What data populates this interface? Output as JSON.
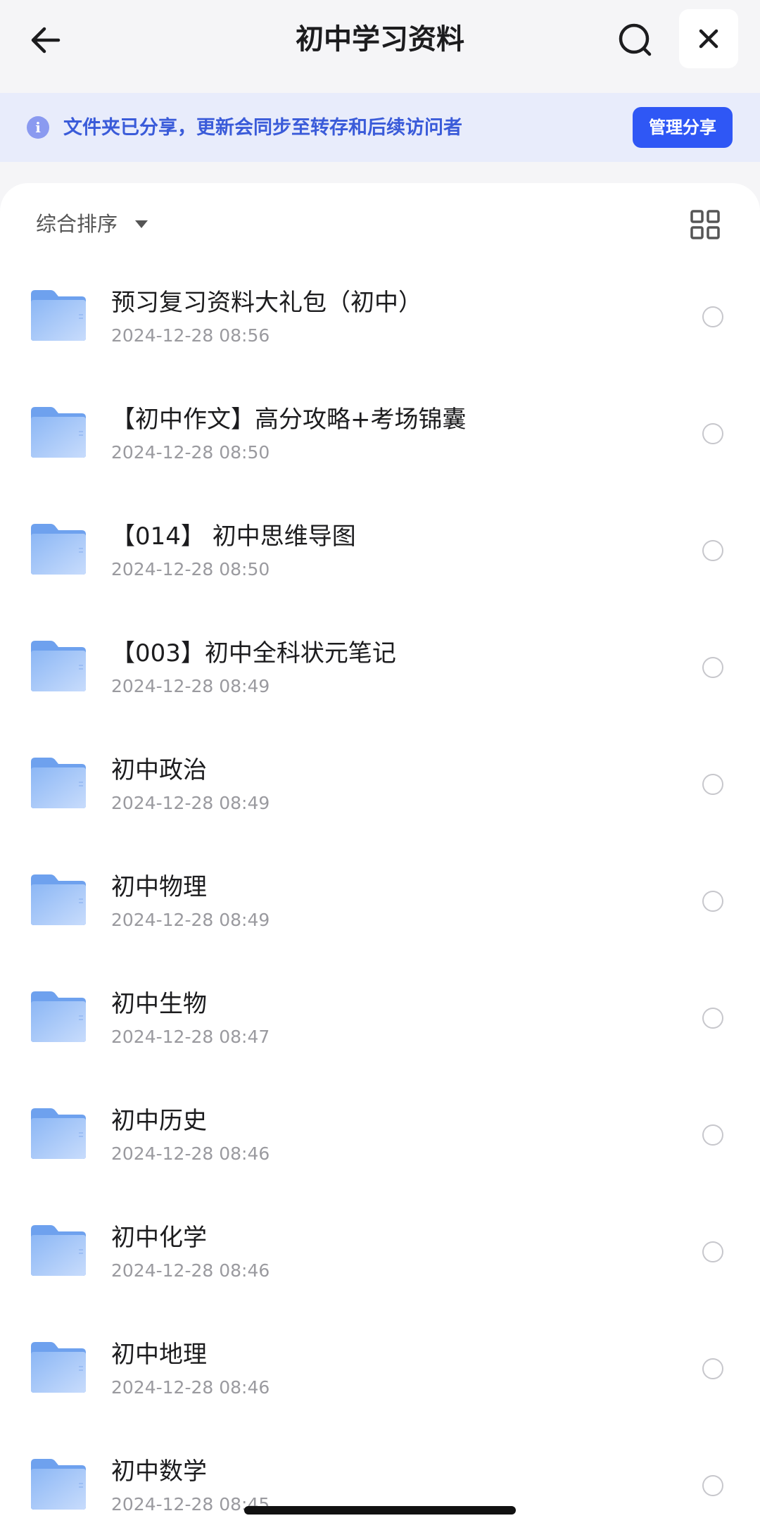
{
  "header": {
    "title": "初中学习资料",
    "back_icon": "arrow-left-icon",
    "search_icon": "search-icon",
    "close_icon": "close-icon"
  },
  "banner": {
    "icon": "info-icon",
    "info_glyph": "i",
    "text": "文件夹已分享，更新会同步至转存和后续访问者",
    "manage_label": "管理分享"
  },
  "toolbar": {
    "sort_label": "综合排序",
    "view_icon": "grid-view-icon"
  },
  "items": [
    {
      "name": "预习复习资料大礼包（初中）",
      "date": "2024-12-28 08:56"
    },
    {
      "name": "【初中作文】高分攻略+考场锦囊",
      "date": "2024-12-28 08:50"
    },
    {
      "name": "【014】 初中思维导图",
      "date": "2024-12-28 08:50"
    },
    {
      "name": "【003】初中全科状元笔记",
      "date": "2024-12-28 08:49"
    },
    {
      "name": "初中政治",
      "date": "2024-12-28 08:49"
    },
    {
      "name": "初中物理",
      "date": "2024-12-28 08:49"
    },
    {
      "name": "初中生物",
      "date": "2024-12-28 08:47"
    },
    {
      "name": "初中历史",
      "date": "2024-12-28 08:46"
    },
    {
      "name": "初中化学",
      "date": "2024-12-28 08:46"
    },
    {
      "name": "初中地理",
      "date": "2024-12-28 08:46"
    },
    {
      "name": "初中数学",
      "date": "2024-12-28 08:45"
    }
  ],
  "colors": {
    "accent": "#2f57f5",
    "banner_bg": "#e8ecfb",
    "banner_text": "#3a5bd9",
    "folder_light": "#b9d3fb",
    "folder_dark": "#6ea1ee"
  }
}
